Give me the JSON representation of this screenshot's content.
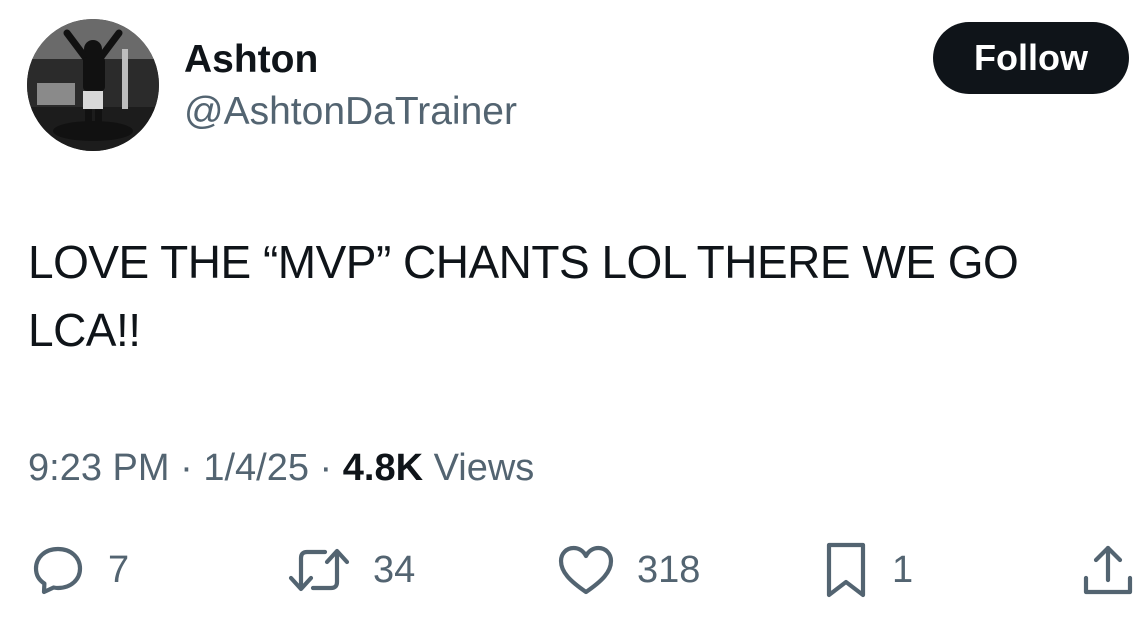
{
  "author": {
    "display_name": "Ashton",
    "handle": "@AshtonDaTrainer"
  },
  "follow_label": "Follow",
  "tweet": {
    "text_lines": [
      "LOVE THE “MVP” CHANTS LOL THERE WE GO",
      "LCA!!"
    ]
  },
  "meta": {
    "time": "9:23 PM",
    "separator": "·",
    "date": "1/4/25",
    "views_count": "4.8K",
    "views_label": "Views"
  },
  "actions": {
    "replies": {
      "icon": "reply-icon",
      "count": "7"
    },
    "reposts": {
      "icon": "repost-icon",
      "count": "34"
    },
    "likes": {
      "icon": "heart-icon",
      "count": "318"
    },
    "bookmarks": {
      "icon": "bookmark-icon",
      "count": "1"
    },
    "share": {
      "icon": "share-icon"
    }
  },
  "colors": {
    "primary_text": "#0f1419",
    "secondary_text": "#536471",
    "button_bg": "#0f1419",
    "button_text": "#ffffff"
  }
}
